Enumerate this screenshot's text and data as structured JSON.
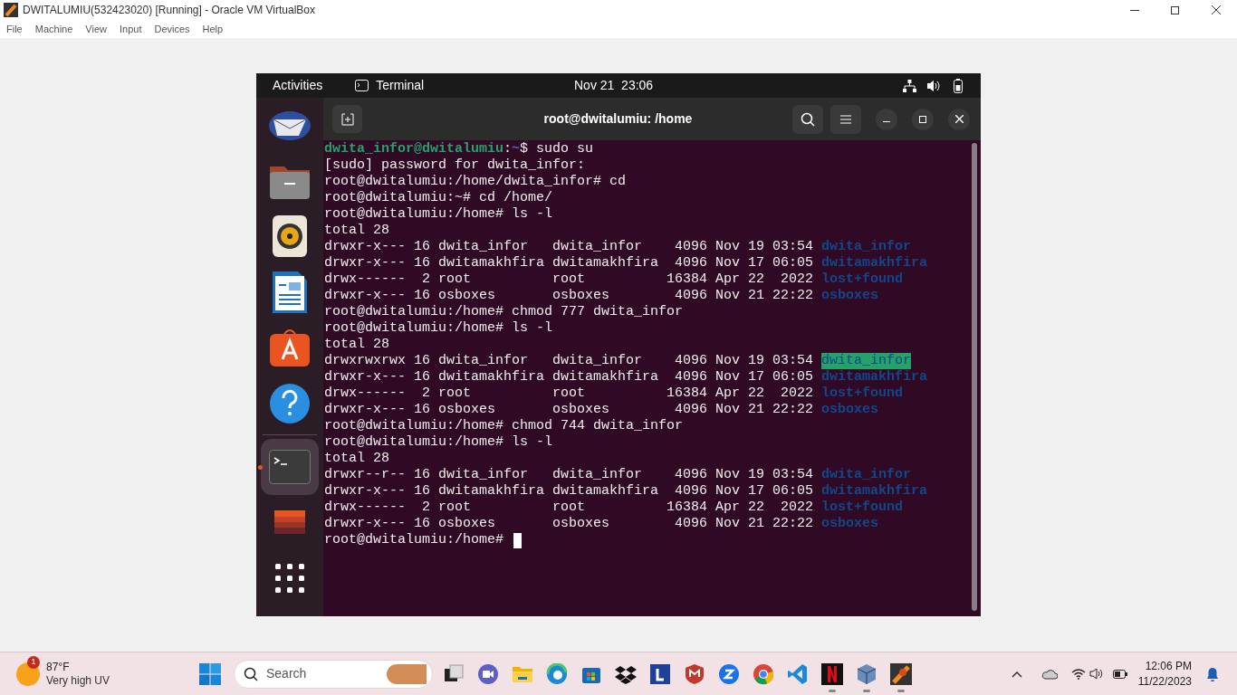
{
  "window": {
    "title": "DWITALUMIU(532423020) [Running] - Oracle VM VirtualBox"
  },
  "menu": [
    "File",
    "Machine",
    "View",
    "Input",
    "Devices",
    "Help"
  ],
  "guest": {
    "top_bar": {
      "activities": "Activities",
      "app": "Terminal",
      "clock": "Nov 21  23:06"
    },
    "dock": [
      {
        "kind": "mail",
        "running": false,
        "selected": false
      },
      {
        "kind": "files",
        "running": false,
        "selected": false
      },
      {
        "kind": "music",
        "running": false,
        "selected": false
      },
      {
        "kind": "writer",
        "running": false,
        "selected": false
      },
      {
        "kind": "store",
        "running": false,
        "selected": false
      },
      {
        "kind": "help",
        "running": false,
        "selected": false
      },
      {
        "kind": "terminal",
        "running": true,
        "selected": true
      },
      {
        "kind": "screenshot",
        "running": false,
        "selected": false
      },
      {
        "kind": "apps",
        "running": false,
        "selected": false
      }
    ],
    "terminal": {
      "title": "root@dwitalumiu: /home",
      "lines": [
        [
          {
            "text": "dwita_infor@dwitalumiu",
            "kind": "user"
          },
          {
            "text": ":",
            "kind": "plain"
          },
          {
            "text": "~",
            "kind": "path"
          },
          {
            "text": "$ sudo su",
            "kind": "plain"
          }
        ],
        [
          {
            "text": "[sudo] password for dwita_infor:",
            "kind": "plain"
          }
        ],
        [
          {
            "text": "root@dwitalumiu:/home/dwita_infor# cd",
            "kind": "plain"
          }
        ],
        [
          {
            "text": "root@dwitalumiu:~# cd /home/",
            "kind": "plain"
          }
        ],
        [
          {
            "text": "root@dwitalumiu:/home# ls -l",
            "kind": "plain"
          }
        ],
        [
          {
            "text": "total 28",
            "kind": "plain"
          }
        ],
        [
          {
            "text": "drwxr-x--- 16 dwita_infor   dwita_infor    4096 Nov 19 03:54 ",
            "kind": "plain"
          },
          {
            "text": "dwita_infor",
            "kind": "dir"
          }
        ],
        [
          {
            "text": "drwxr-x--- 16 dwitamakhfira dwitamakhfira  4096 Nov 17 06:05 ",
            "kind": "plain"
          },
          {
            "text": "dwitamakhfira",
            "kind": "dir"
          }
        ],
        [
          {
            "text": "drwx------  2 root          root          16384 Apr 22  2022 ",
            "kind": "plain"
          },
          {
            "text": "lost+found",
            "kind": "dir"
          }
        ],
        [
          {
            "text": "drwxr-x--- 16 osboxes       osboxes        4096 Nov 21 22:22 ",
            "kind": "plain"
          },
          {
            "text": "osboxes",
            "kind": "dir"
          }
        ],
        [
          {
            "text": "root@dwitalumiu:/home# chmod 777 dwita_infor",
            "kind": "plain"
          }
        ],
        [
          {
            "text": "root@dwitalumiu:/home# ls -l",
            "kind": "plain"
          }
        ],
        [
          {
            "text": "total 28",
            "kind": "plain"
          }
        ],
        [
          {
            "text": "drwxrwxrwx 16 dwita_infor   dwita_infor    4096 Nov 19 03:54 ",
            "kind": "plain"
          },
          {
            "text": "dwita_infor",
            "kind": "dir_writable"
          }
        ],
        [
          {
            "text": "drwxr-x--- 16 dwitamakhfira dwitamakhfira  4096 Nov 17 06:05 ",
            "kind": "plain"
          },
          {
            "text": "dwitamakhfira",
            "kind": "dir"
          }
        ],
        [
          {
            "text": "drwx------  2 root          root          16384 Apr 22  2022 ",
            "kind": "plain"
          },
          {
            "text": "lost+found",
            "kind": "dir"
          }
        ],
        [
          {
            "text": "drwxr-x--- 16 osboxes       osboxes        4096 Nov 21 22:22 ",
            "kind": "plain"
          },
          {
            "text": "osboxes",
            "kind": "dir"
          }
        ],
        [
          {
            "text": "root@dwitalumiu:/home# chmod 744 dwita_infor",
            "kind": "plain"
          }
        ],
        [
          {
            "text": "root@dwitalumiu:/home# ls -l",
            "kind": "plain"
          }
        ],
        [
          {
            "text": "total 28",
            "kind": "plain"
          }
        ],
        [
          {
            "text": "drwxr--r-- 16 dwita_infor   dwita_infor    4096 Nov 19 03:54 ",
            "kind": "plain"
          },
          {
            "text": "dwita_infor",
            "kind": "dir"
          }
        ],
        [
          {
            "text": "drwxr-x--- 16 dwitamakhfira dwitamakhfira  4096 Nov 17 06:05 ",
            "kind": "plain"
          },
          {
            "text": "dwitamakhfira",
            "kind": "dir"
          }
        ],
        [
          {
            "text": "drwx------  2 root          root          16384 Apr 22  2022 ",
            "kind": "plain"
          },
          {
            "text": "lost+found",
            "kind": "dir"
          }
        ],
        [
          {
            "text": "drwxr-x--- 16 osboxes       osboxes        4096 Nov 21 22:22 ",
            "kind": "plain"
          },
          {
            "text": "osboxes",
            "kind": "dir"
          }
        ],
        [
          {
            "text": "root@dwitalumiu:/home# ",
            "kind": "plain"
          },
          {
            "kind": "cursor"
          }
        ]
      ]
    }
  },
  "taskbar": {
    "weather": {
      "badge": "1",
      "temperature": "87°F",
      "condition": "Very high UV"
    },
    "search": {
      "placeholder": "Search"
    },
    "apps": [
      {
        "kind": "taskview",
        "running": false
      },
      {
        "kind": "meet",
        "running": false
      },
      {
        "kind": "explorer",
        "running": false
      },
      {
        "kind": "edge",
        "running": false
      },
      {
        "kind": "store",
        "running": false
      },
      {
        "kind": "dropbox",
        "running": false
      },
      {
        "kind": "l",
        "running": false
      },
      {
        "kind": "shield",
        "running": false
      },
      {
        "kind": "z",
        "running": false
      },
      {
        "kind": "chrome",
        "running": false
      },
      {
        "kind": "vscode",
        "running": false
      },
      {
        "kind": "netflix",
        "running": true
      },
      {
        "kind": "vbox",
        "running": true
      },
      {
        "kind": "vm",
        "running": true
      }
    ],
    "time": "12:06 PM",
    "date": "11/22/2023"
  }
}
